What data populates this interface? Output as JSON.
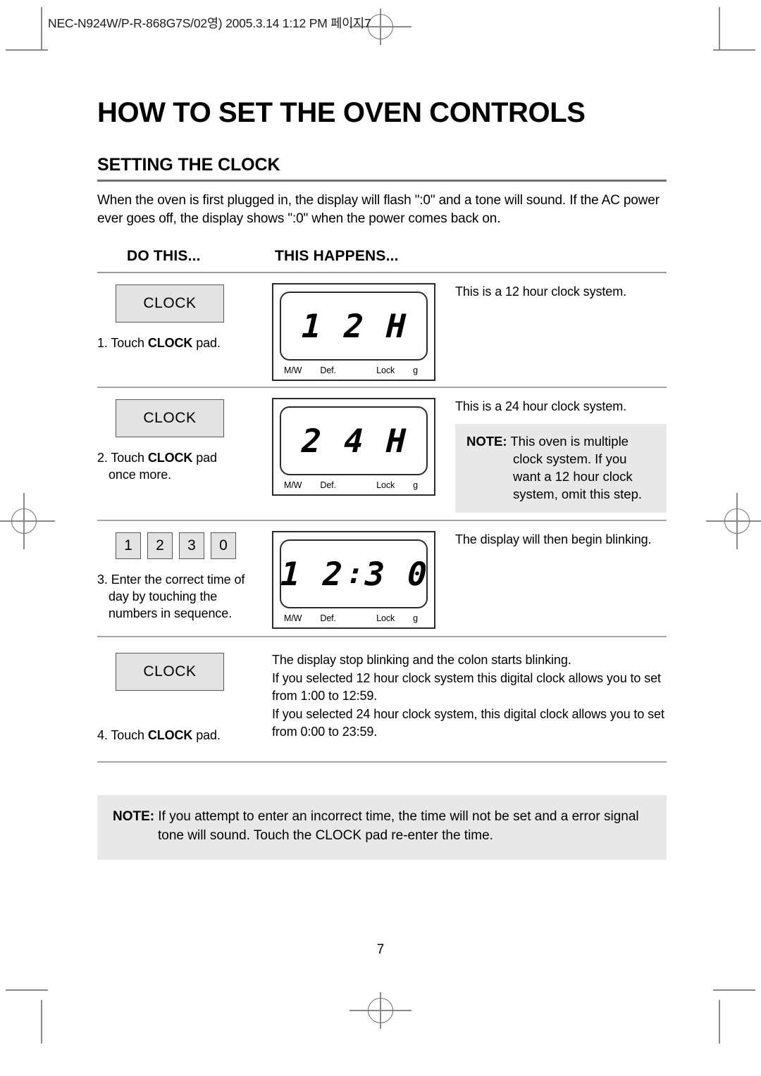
{
  "print_marks": {
    "file_stamp": "NEC-N924W/P-R-868G7S/02영)  2005.3.14 1:12 PM  페이지7"
  },
  "document": {
    "title": "HOW TO SET THE OVEN CONTROLS",
    "section_title": "SETTING THE CLOCK",
    "intro": "When the oven is first plugged in, the display will flash \":0\" and a tone will sound. If the AC power ever goes off, the display shows \":0\" when the power  comes back on.",
    "page_number": "7"
  },
  "columns": {
    "do_this": "DO THIS...",
    "this_happens": "THIS HAPPENS..."
  },
  "lcd_labels": {
    "mw": "M/W",
    "def": "Def.",
    "lock": "Lock",
    "g": "g"
  },
  "steps": [
    {
      "pad_type": "clock",
      "pad_label": "CLOCK",
      "instruction_number": "1.",
      "instruction_pre": "Touch ",
      "instruction_bold": "CLOCK",
      "instruction_post": " pad.",
      "instruction_line2": "",
      "display": [
        "1",
        "",
        "2",
        "",
        "H"
      ],
      "result": "This is a 12 hour clock system.",
      "note": null
    },
    {
      "pad_type": "clock",
      "pad_label": "CLOCK",
      "instruction_number": "2.",
      "instruction_pre": "Touch ",
      "instruction_bold": "CLOCK",
      "instruction_post": " pad",
      "instruction_line2": "once more.",
      "display": [
        "2",
        "",
        "4",
        "",
        "H"
      ],
      "result": "This is a 24 hour clock system.",
      "note": {
        "label": "NOTE:",
        "lines": [
          "This oven is multiple",
          "clock system. If you",
          "want a 12 hour clock",
          "system, omit this step."
        ]
      }
    },
    {
      "pad_type": "numbers",
      "pad_keys": [
        "1",
        "2",
        "3",
        "0"
      ],
      "instruction_number": "3.",
      "instruction_pre": "Enter the correct time of",
      "instruction_bold": "",
      "instruction_post": "",
      "instruction_line2": "day by touching the",
      "instruction_line3": "numbers in sequence.",
      "display": [
        "1",
        "",
        "2",
        ":",
        "3",
        "",
        "0"
      ],
      "result": "The display will then begin blinking.",
      "note": null
    },
    {
      "pad_type": "clock",
      "pad_label": "CLOCK",
      "instruction_number": "4.",
      "instruction_pre": "Touch ",
      "instruction_bold": "CLOCK",
      "instruction_post": " pad.",
      "instruction_line2": "",
      "display": null,
      "result_lines": [
        "The display stop blinking and the colon starts blinking.",
        "If you selected 12 hour clock system this digital clock allows you to set",
        "from 1:00 to 12:59.",
        "If you selected 24 hour clock system, this digital clock allows you to set",
        "from 0:00 to 23:59."
      ],
      "note": null
    }
  ],
  "bottom_note": {
    "label": "NOTE:",
    "line1": "If you attempt to enter an incorrect time, the time will not be set and a error signal",
    "line2": "tone will sound. Touch the CLOCK pad re-enter the time."
  }
}
